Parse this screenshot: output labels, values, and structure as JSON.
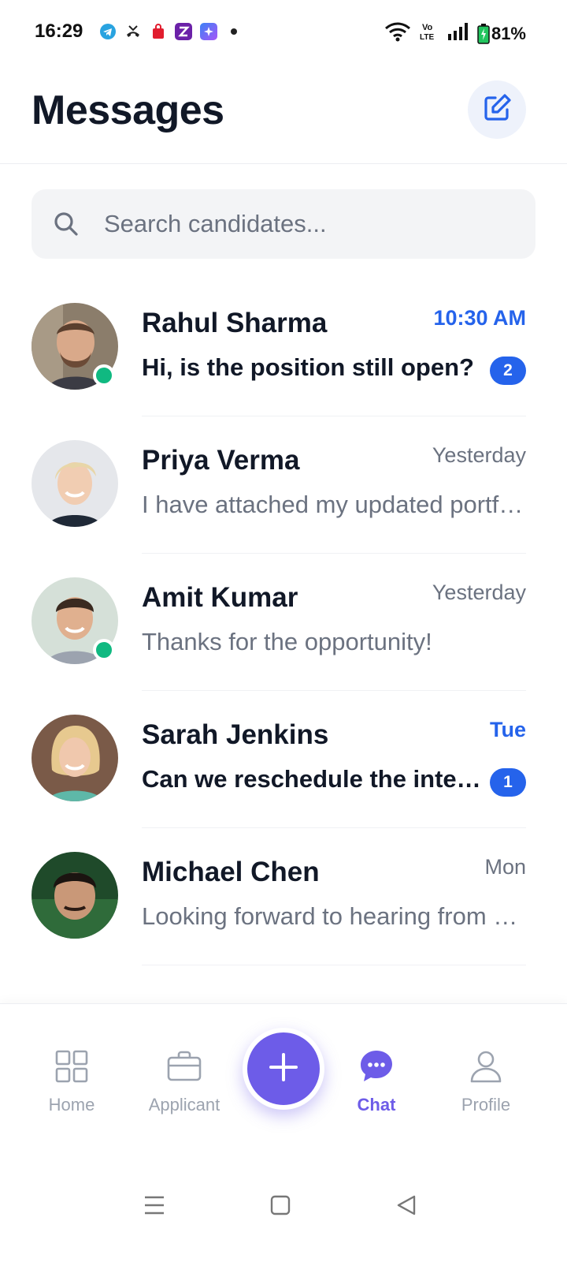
{
  "status_bar": {
    "time": "16:29",
    "battery": "81%",
    "notification_icons": [
      "telegram-icon",
      "missed-call-icon",
      "shopping-bag-icon",
      "zepto-icon",
      "app-icon",
      "dot-icon"
    ],
    "system_icons": [
      "wifi-icon",
      "volte-icon",
      "signal-icon",
      "battery-icon"
    ]
  },
  "header": {
    "title": "Messages",
    "compose_icon": "compose-icon"
  },
  "search": {
    "placeholder": "Search candidates..."
  },
  "conversations": [
    {
      "name": "Rahul Sharma",
      "time": "10:30 AM",
      "preview": "Hi, is the position still open?",
      "unread_count": "2",
      "online": true,
      "unread": true
    },
    {
      "name": "Priya Verma",
      "time": "Yesterday",
      "preview": "I have attached my updated portfolio.",
      "unread_count": "",
      "online": false,
      "unread": false
    },
    {
      "name": "Amit Kumar",
      "time": "Yesterday",
      "preview": "Thanks for the opportunity!",
      "unread_count": "",
      "online": true,
      "unread": false
    },
    {
      "name": "Sarah Jenkins",
      "time": "Tue",
      "preview": "Can we reschedule the interview?",
      "unread_count": "1",
      "online": false,
      "unread": true
    },
    {
      "name": "Michael Chen",
      "time": "Mon",
      "preview": "Looking forward to hearing from you.",
      "unread_count": "",
      "online": false,
      "unread": false
    }
  ],
  "bottom_nav": {
    "items": [
      {
        "label": "Home",
        "icon": "grid-icon"
      },
      {
        "label": "Applicant",
        "icon": "briefcase-icon"
      },
      {
        "label": "Chat",
        "icon": "chat-bubble-icon",
        "active": true
      },
      {
        "label": "Profile",
        "icon": "user-icon"
      }
    ],
    "fab_icon": "plus-icon"
  },
  "colors": {
    "accent": "#6d5ce8",
    "unread_blue": "#2563eb",
    "online_green": "#10b981",
    "text_primary": "#111827",
    "text_secondary": "#6b7280"
  }
}
